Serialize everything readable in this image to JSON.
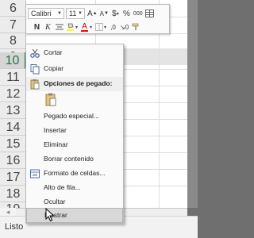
{
  "sheet": {
    "rows": [
      "6",
      "7",
      "8",
      "9",
      "10",
      "11",
      "12",
      "13",
      "14",
      "15",
      "16",
      "17",
      "18",
      "19"
    ],
    "selected_row": "10"
  },
  "mini_toolbar": {
    "font_name": "Calibri",
    "font_size": "11",
    "grow_font": "A",
    "shrink_font": "A",
    "currency": "$",
    "percent": "%",
    "comma": "000",
    "bold": "N",
    "italic": "K",
    "font_color_letter": "A",
    "decimals": ",0",
    "icons": [
      "increase-font-icon",
      "decrease-font-icon",
      "currency-icon",
      "percent-icon",
      "thousands-icon",
      "format-table-icon",
      "bold-icon",
      "italic-icon",
      "align-center-icon",
      "fill-color-icon",
      "font-color-icon",
      "borders-icon",
      "increase-decimal-icon",
      "decrease-decimal-icon",
      "format-painter-icon"
    ],
    "fill_color": "#ffff00",
    "font_color": "#ff0000"
  },
  "context_menu": {
    "cut": "Cortar",
    "copy": "Copiar",
    "paste_options_header": "Opciones de pegado:",
    "paste_special": "Pegado especial...",
    "insert": "Insertar",
    "delete": "Eliminar",
    "clear_contents": "Borrar contenido",
    "format_cells": "Formato de celdas...",
    "row_height": "Alto de fila...",
    "hide": "Ocultar",
    "unhide": "Mostrar",
    "highlighted_item": "Mostrar"
  },
  "status_bar": {
    "text": "Listo"
  },
  "colors": {
    "accent": "#217346",
    "menu_bg": "#fafafa",
    "highlight": "#d8d8d8"
  }
}
